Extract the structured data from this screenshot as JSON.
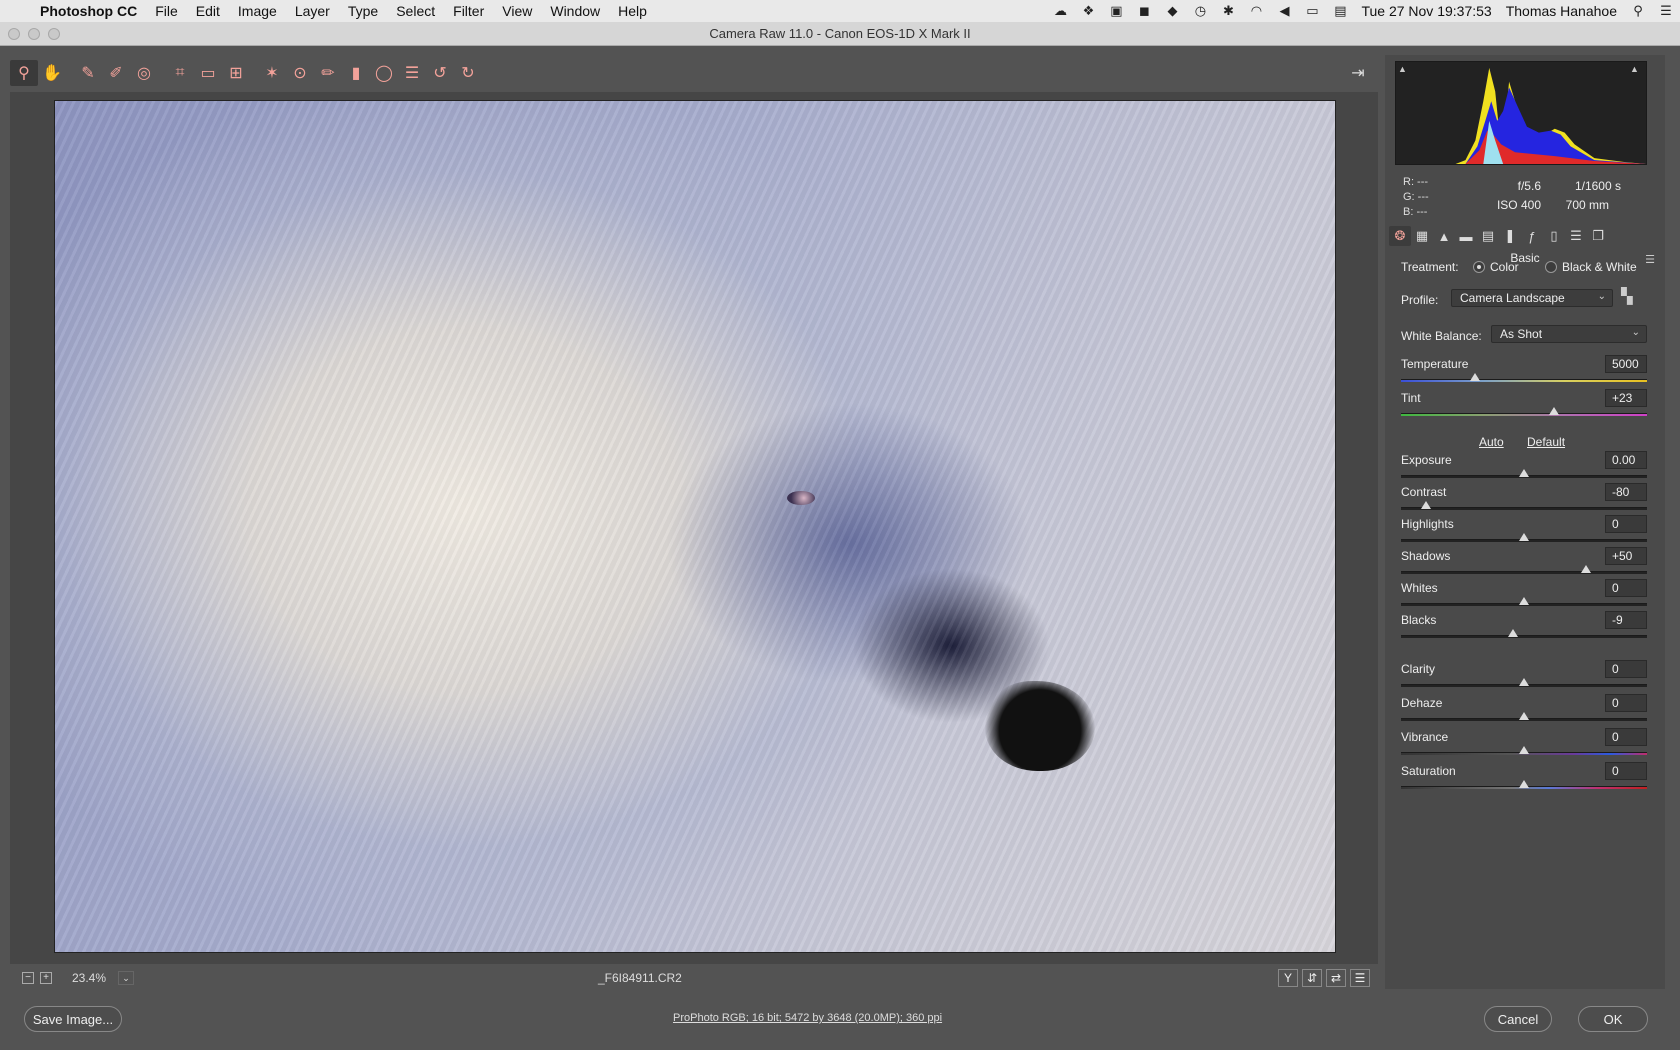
{
  "menubar": {
    "app": "Photoshop CC",
    "items": [
      "File",
      "Edit",
      "Image",
      "Layer",
      "Type",
      "Select",
      "Filter",
      "View",
      "Window",
      "Help"
    ],
    "clock": "Tue 27 Nov  19:37:53",
    "user": "Thomas Hanahoe"
  },
  "window": {
    "title": "Camera Raw 11.0  -  Canon EOS-1D X Mark II"
  },
  "toolbar": {
    "tools": [
      "zoom-icon",
      "hand-icon",
      "white-balance-icon",
      "color-sampler-icon",
      "targeted-adjustment-icon",
      "crop-icon",
      "straighten-icon",
      "transform-icon",
      "spot-removal-icon",
      "red-eye-icon",
      "adjustment-brush-icon",
      "graduated-filter-icon",
      "radial-filter-icon",
      "preferences-icon",
      "rotate-left-icon",
      "rotate-right-icon"
    ]
  },
  "status": {
    "zoom": "23.4%",
    "filename": "_F6I84911.CR2"
  },
  "meta": {
    "r": "R:   ---",
    "g": "G:   ---",
    "b": "B:   ---",
    "aperture": "f/5.6",
    "shutter": "1/1600 s",
    "iso": "ISO 400",
    "focal": "700 mm"
  },
  "panel": {
    "section": "Basic",
    "treatment_label": "Treatment:",
    "treatment_color": "Color",
    "treatment_bw": "Black & White",
    "profile_label": "Profile:",
    "profile_value": "Camera Landscape",
    "wb_label": "White Balance:",
    "wb_value": "As Shot",
    "auto": "Auto",
    "default": "Default"
  },
  "sliders": {
    "temperature": {
      "label": "Temperature",
      "value": "5000",
      "pos": 0.3
    },
    "tint": {
      "label": "Tint",
      "value": "+23",
      "pos": 0.62
    },
    "exposure": {
      "label": "Exposure",
      "value": "0.00",
      "pos": 0.5
    },
    "contrast": {
      "label": "Contrast",
      "value": "-80",
      "pos": 0.1
    },
    "highlights": {
      "label": "Highlights",
      "value": "0",
      "pos": 0.5
    },
    "shadows": {
      "label": "Shadows",
      "value": "+50",
      "pos": 0.75
    },
    "whites": {
      "label": "Whites",
      "value": "0",
      "pos": 0.5
    },
    "blacks": {
      "label": "Blacks",
      "value": "-9",
      "pos": 0.455
    },
    "clarity": {
      "label": "Clarity",
      "value": "0",
      "pos": 0.5
    },
    "dehaze": {
      "label": "Dehaze",
      "value": "0",
      "pos": 0.5
    },
    "vibrance": {
      "label": "Vibrance",
      "value": "0",
      "pos": 0.5
    },
    "saturation": {
      "label": "Saturation",
      "value": "0",
      "pos": 0.5
    }
  },
  "bottom": {
    "save": "Save Image...",
    "workflow": "ProPhoto RGB; 16 bit; 5472 by 3648 (20.0MP); 360 ppi",
    "cancel": "Cancel",
    "ok": "OK"
  }
}
